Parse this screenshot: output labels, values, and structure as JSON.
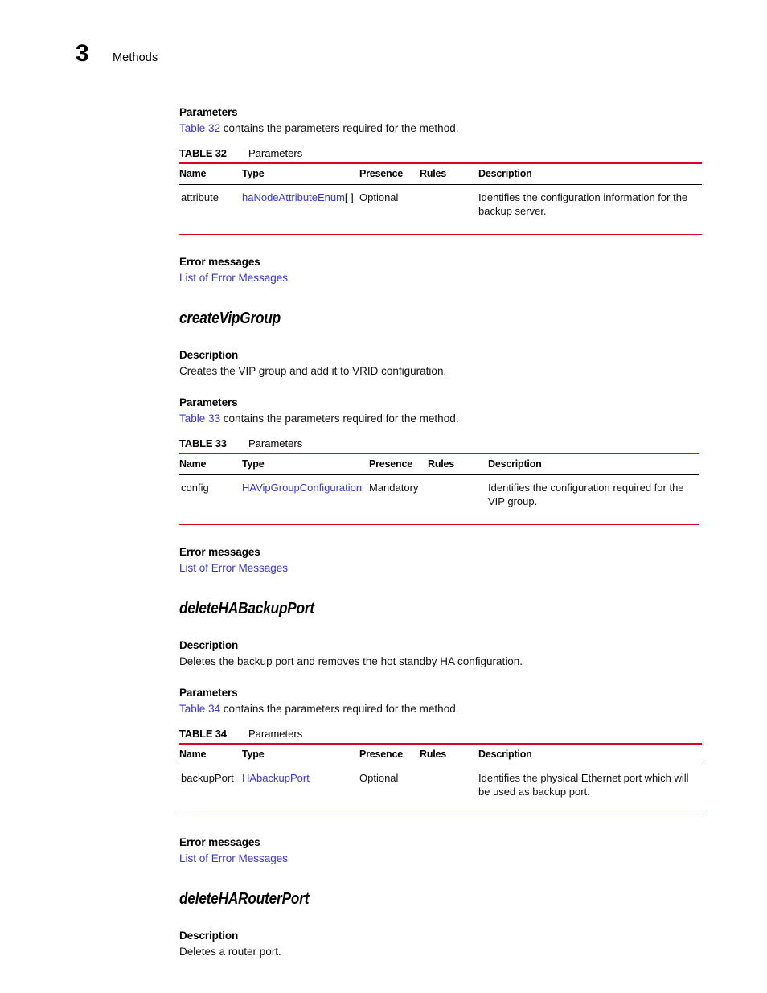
{
  "header": {
    "chapter_number": "3",
    "chapter_title": "Methods"
  },
  "labels": {
    "parameters_heading": "Parameters",
    "description_heading": "Description",
    "error_messages_heading": "Error messages",
    "error_messages_link": "List of Error Messages",
    "table_title": "Parameters"
  },
  "columns": {
    "name": "Name",
    "type": "Type",
    "presence": "Presence",
    "rules": "Rules",
    "description": "Description"
  },
  "colors": {
    "link": "#3333ff",
    "rule_red": "#e00024",
    "rule_black": "#000000"
  },
  "sections": [
    {
      "id": "section-createhabackupserver-tail",
      "method_name": null,
      "description_text": null,
      "parameters_intro_link": "Table 32",
      "parameters_intro_rest": " contains the parameters required for the method.",
      "table": {
        "label": "TABLE 32",
        "title": "Parameters",
        "layout": "a",
        "rows": [
          {
            "name": "attribute",
            "type_link": "haNodeAttributeEnum",
            "type_suffix": "[ ]",
            "presence": "Optional",
            "rules": "",
            "description": "Identifies the configuration information for the backup server."
          }
        ]
      }
    },
    {
      "id": "section-createvipgroup",
      "method_name": "createVipGroup",
      "description_text": "Creates the VIP group and add it to VRID configuration.",
      "parameters_intro_link": "Table 33",
      "parameters_intro_rest": " contains the parameters required for the method.",
      "table": {
        "label": "TABLE 33",
        "title": "Parameters",
        "layout": "b",
        "rows": [
          {
            "name": "config",
            "type_link": "HAVipGroupConfiguration",
            "type_suffix": "",
            "presence": "Mandatory",
            "rules": "",
            "description": "Identifies the configuration required for the VIP group."
          }
        ]
      }
    },
    {
      "id": "section-deletehabackupport",
      "method_name": "deleteHABackupPort",
      "description_text": "Deletes the backup port and removes the hot standby HA configuration.",
      "parameters_intro_link": "Table 34",
      "parameters_intro_rest": " contains the parameters required for the method.",
      "table": {
        "label": "TABLE 34",
        "title": "Parameters",
        "layout": "a",
        "rows": [
          {
            "name": "backupPort",
            "type_link": "HAbackupPort",
            "type_suffix": "",
            "presence": "Optional",
            "rules": "",
            "description": "Identifies the physical Ethernet port which will be used as backup port."
          }
        ]
      }
    },
    {
      "id": "section-deleteharouterport",
      "method_name": "deleteHARouterPort",
      "description_text": "Deletes a router port.",
      "parameters_intro_link": null,
      "parameters_intro_rest": null,
      "table": null
    }
  ]
}
